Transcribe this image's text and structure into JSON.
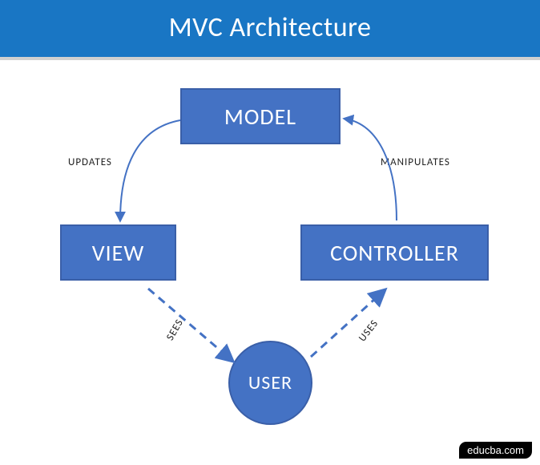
{
  "title": "MVC Architecture",
  "nodes": {
    "model": "MODEL",
    "view": "VIEW",
    "controller": "CONTROLLER",
    "user": "USER"
  },
  "edges": {
    "model_to_view": "UPDATES",
    "controller_to_model": "MANIPULATES",
    "view_to_user": "SEES",
    "user_to_controller": "USES"
  },
  "colors": {
    "title_bg": "#1976c4",
    "node_fill": "#4472c4",
    "node_border": "#3a5fa8",
    "arrow_solid": "#4472c4",
    "arrow_dashed": "#4472c4"
  },
  "attribution": "educba.com"
}
